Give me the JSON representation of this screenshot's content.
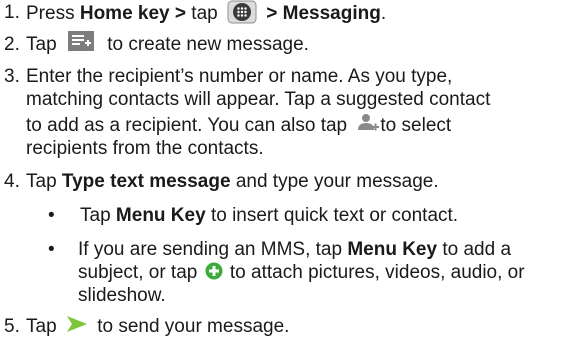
{
  "steps": [
    {
      "number": "1.",
      "pre": "Press ",
      "bold1": "Home key >",
      "mid": " tap ",
      "icon": "apps-grid-icon",
      "bold2": " > Messaging",
      "post": "."
    },
    {
      "number": "2.",
      "pre": "Tap ",
      "icon": "new-message-icon",
      "post": " to create new message."
    },
    {
      "number": "3.",
      "line1": "Enter the recipient’s number or name. As you type,",
      "line2": "matching contacts will appear. Tap a suggested contact",
      "line3_pre": "to add as a recipient. You can also tap ",
      "icon": "add-contact-icon",
      "line3_post": "to select",
      "line4": "recipients from the contacts."
    },
    {
      "number": "4.",
      "pre": "Tap ",
      "bold": "Type text message",
      "post": " and type your message.",
      "bullets": [
        {
          "pre": "Tap ",
          "bold": "Menu Key",
          "post": " to insert quick text or contact."
        },
        {
          "line1_pre": "If you are sending an MMS, tap ",
          "bold": "Menu Key",
          "line1_post": " to add a",
          "line2_pre": "subject, or tap ",
          "icon": "attach-plus-icon",
          "line2_post": " to attach pictures, videos, audio, or",
          "line3": "slideshow."
        }
      ]
    },
    {
      "number": "5.",
      "pre": "Tap ",
      "icon": "send-arrow-icon",
      "post": " to send your message."
    }
  ],
  "bullet_char": "•",
  "colors": {
    "text": "#1a1a1a",
    "send_icon": "#7cc63a",
    "attach_icon": "#3daa3d",
    "grey_icon": "#8a8a8a"
  }
}
